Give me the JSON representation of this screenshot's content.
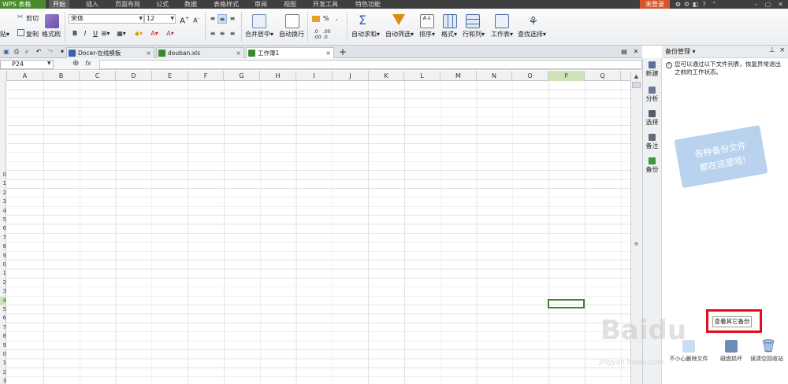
{
  "app": {
    "name": "WPS 表格",
    "login": "未登录"
  },
  "menu": [
    "开始",
    "插入",
    "页面布局",
    "公式",
    "数据",
    "表格样式",
    "审阅",
    "视图",
    "开发工具",
    "特色功能"
  ],
  "ribbon": {
    "paste": "贴",
    "cut": "剪切",
    "copy": "复制",
    "format_painter": "格式刷",
    "font_name": "宋体",
    "font_size": "12",
    "bold": "B",
    "italic": "I",
    "underline": "U",
    "merge_center": "合并居中",
    "wrap": "自动换行",
    "percent": "%",
    "autosum": "自动求和",
    "autofilter": "自动筛选",
    "sort": "排序",
    "format": "格式",
    "row_col": "行和列",
    "worksheet": "工作表",
    "find_select": "查找选择"
  },
  "tabs": [
    {
      "label": "Docer-在线模板",
      "active": false
    },
    {
      "label": "douban.xls",
      "active": false
    },
    {
      "label": "工作簿1",
      "active": true
    }
  ],
  "namebox": "P24",
  "fx": "fx",
  "columns": [
    "A",
    "B",
    "C",
    "D",
    "E",
    "F",
    "G",
    "H",
    "I",
    "J",
    "K",
    "L",
    "M",
    "N",
    "O",
    "P",
    "Q"
  ],
  "selected_column": "P",
  "rows": [
    "",
    "",
    "",
    "",
    "",
    "",
    "",
    "",
    "",
    "",
    "0",
    "1",
    "2",
    "3",
    "4",
    "5",
    "6",
    "7",
    "8",
    "9",
    "0",
    "1",
    "2",
    "3",
    "4",
    "5",
    "6",
    "7",
    "8",
    "9",
    "0",
    "1",
    "2",
    "3"
  ],
  "taskbar": [
    "新建",
    "分析",
    "选择",
    "备注",
    "备份"
  ],
  "panel": {
    "title": "备份管理",
    "info": "您可以通过以下文件列表，恢复异常退出之前的工作状态。",
    "card_line1": "各种备份文件",
    "card_line2": "都在这里哦!",
    "view_other": "查看其它备份",
    "actions": [
      "不小心删除文件",
      "磁盘损坏",
      "误清空回收站"
    ]
  },
  "watermark": "Baidu",
  "watermark_url": "jingyan.baidu.com"
}
